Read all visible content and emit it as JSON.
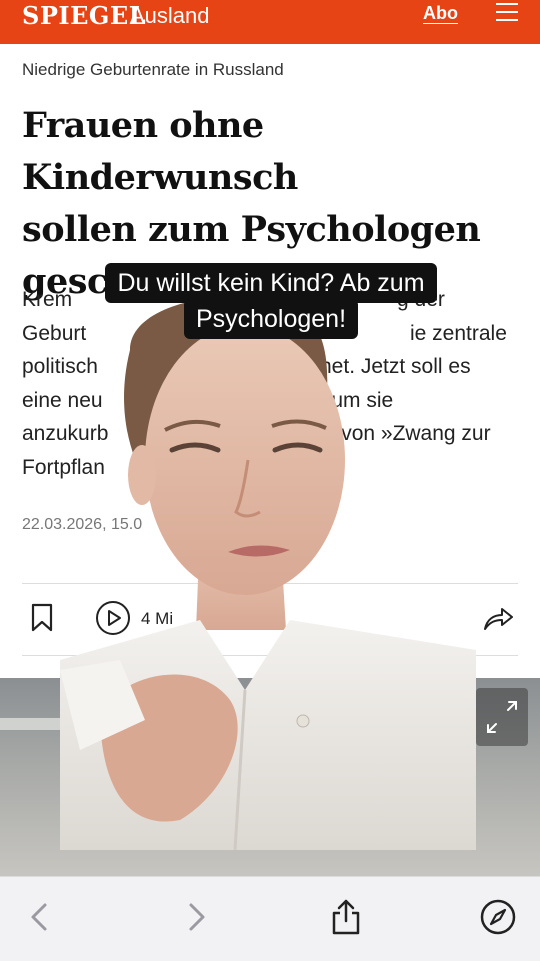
{
  "header": {
    "logo": "SPIEGEL",
    "section": "Ausland",
    "abo": "Abo",
    "menu_icon": "hamburger-menu-icon",
    "brand_color": "#e64415"
  },
  "article": {
    "kicker": "Niedrige Geburtenrate in Russland",
    "headline_lines": [
      "Frauen ohne Kinderwunsch",
      "sollen zum Psychologen",
      "geschickt werden"
    ],
    "lede_lines": [
      {
        "left": "Krem",
        "right": "g der"
      },
      {
        "left": "Geburt",
        "right": "ie zentrale"
      },
      {
        "left": "politisch",
        "right": "net. Jetzt soll es"
      },
      {
        "left": "eine neu",
        "right": "n, um sie"
      },
      {
        "left": "anzukurb",
        "right": "en von »Zwang zur"
      },
      {
        "left": "Fortpflan",
        "right": ""
      }
    ],
    "date": "22.03.2026, 15.0",
    "audio_time": "4 Mi"
  },
  "video_caption": [
    "Du willst kein Kind? Ab zum",
    "Psychologen!"
  ],
  "toolbar": {
    "back_icon": "chevron-left-icon",
    "forward_icon": "chevron-right-icon",
    "share_icon": "share-icon",
    "compass_icon": "compass-icon"
  }
}
